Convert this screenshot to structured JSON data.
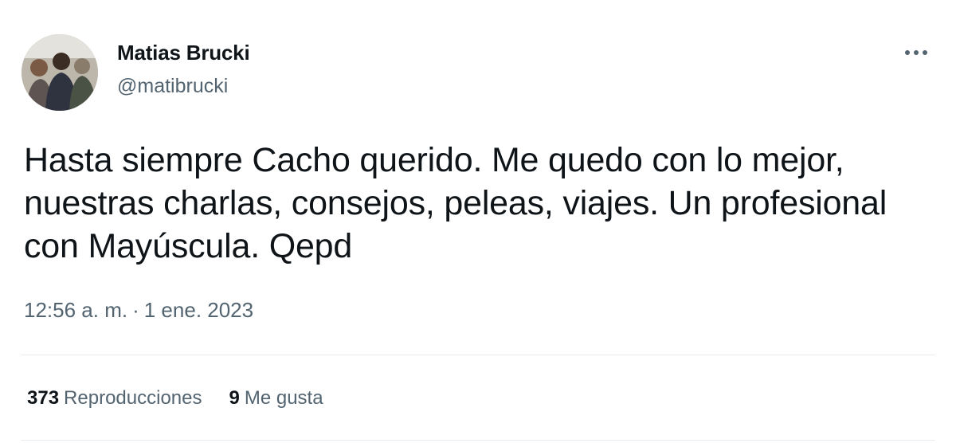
{
  "tweet": {
    "author": {
      "display_name": "Matias Brucki",
      "handle": "@matibrucki"
    },
    "more_icon": "more-horizontal-icon",
    "text": "Hasta siempre Cacho querido. Me quedo con lo mejor, nuestras charlas, consejos, peleas, viajes. Un profesional con Mayúscula. Qepd",
    "time": "12:56 a. m.",
    "separator": "·",
    "date": "1 ene. 2023",
    "stats": {
      "views_count": "373",
      "views_label": "Reproducciones",
      "likes_count": "9",
      "likes_label": "Me gusta"
    }
  },
  "colors": {
    "text_primary": "#0f1419",
    "text_secondary": "#536471",
    "divider": "#e6ecf0"
  }
}
